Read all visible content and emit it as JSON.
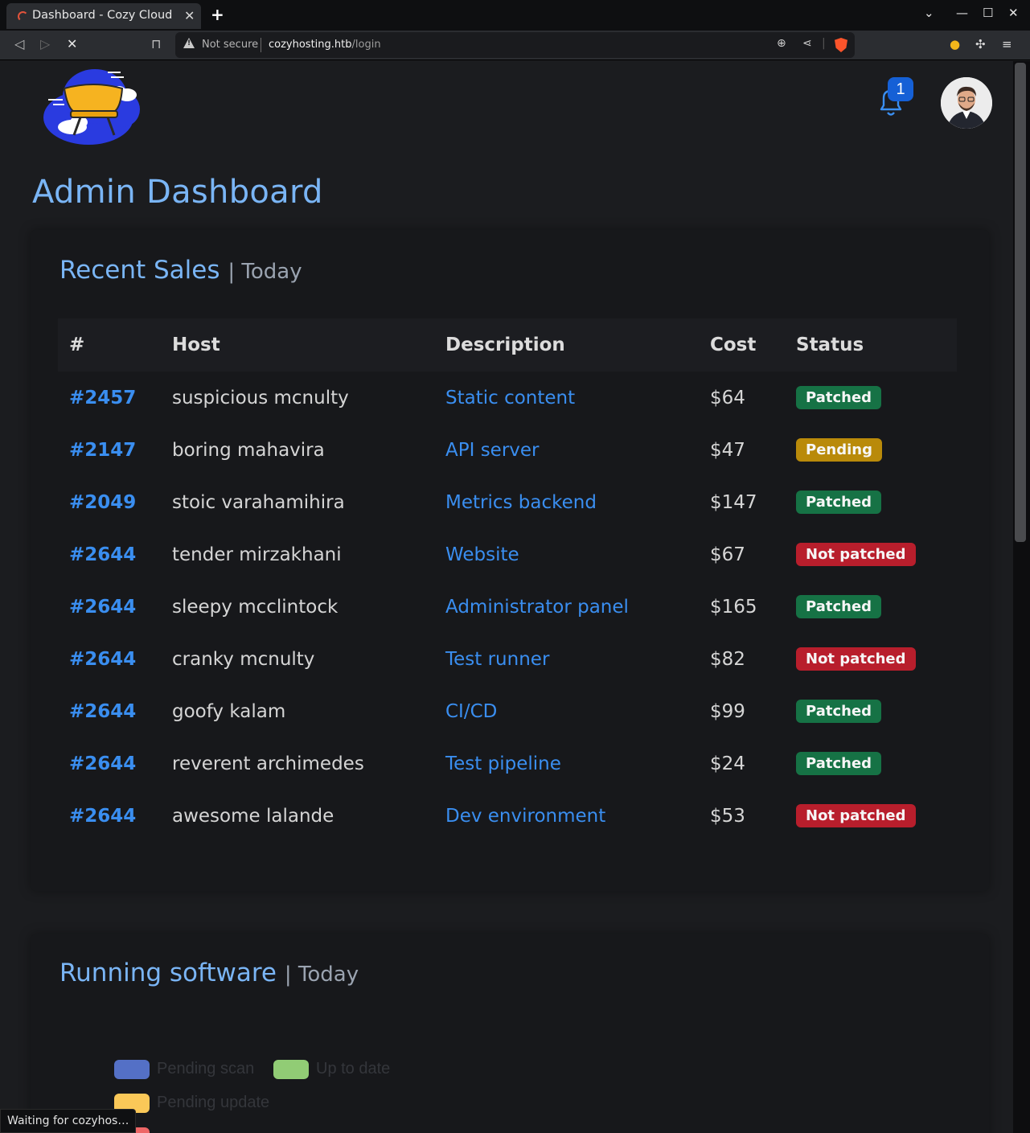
{
  "browser": {
    "tab_title": "Dashboard - Cozy Cloud",
    "url_security": "Not secure",
    "url_host": "cozyhosting.htb",
    "url_path": "/login",
    "status_text": "Waiting for cozyhos…"
  },
  "header": {
    "notification_count": "1"
  },
  "page_title": "Admin Dashboard",
  "sales": {
    "title": "Recent Sales",
    "subtitle": "| Today",
    "columns": [
      "#",
      "Host",
      "Description",
      "Cost",
      "Status"
    ],
    "rows": [
      {
        "id": "#2457",
        "host": "suspicious mcnulty",
        "desc": "Static content",
        "cost": "$64",
        "status": "Patched",
        "kind": "patched"
      },
      {
        "id": "#2147",
        "host": "boring mahavira",
        "desc": "API server",
        "cost": "$47",
        "status": "Pending",
        "kind": "pending"
      },
      {
        "id": "#2049",
        "host": "stoic varahamihira",
        "desc": "Metrics backend",
        "cost": "$147",
        "status": "Patched",
        "kind": "patched"
      },
      {
        "id": "#2644",
        "host": "tender mirzakhani",
        "desc": "Website",
        "cost": "$67",
        "status": "Not patched",
        "kind": "notpatched"
      },
      {
        "id": "#2644",
        "host": "sleepy mcclintock",
        "desc": "Administrator panel",
        "cost": "$165",
        "status": "Patched",
        "kind": "patched"
      },
      {
        "id": "#2644",
        "host": "cranky mcnulty",
        "desc": "Test runner",
        "cost": "$82",
        "status": "Not patched",
        "kind": "notpatched"
      },
      {
        "id": "#2644",
        "host": "goofy kalam",
        "desc": "CI/CD",
        "cost": "$99",
        "status": "Patched",
        "kind": "patched"
      },
      {
        "id": "#2644",
        "host": "reverent archimedes",
        "desc": "Test pipeline",
        "cost": "$24",
        "status": "Patched",
        "kind": "patched"
      },
      {
        "id": "#2644",
        "host": "awesome lalande",
        "desc": "Dev environment",
        "cost": "$53",
        "status": "Not patched",
        "kind": "notpatched"
      }
    ]
  },
  "software": {
    "title": "Running software",
    "subtitle": "| Today",
    "legend": [
      {
        "label": "Pending scan",
        "color": "#5470c6"
      },
      {
        "label": "Up to date",
        "color": "#91cc75"
      },
      {
        "label": "Pending update",
        "color": "#fac858"
      }
    ]
  },
  "colors": {
    "accent": "#7ab5f5",
    "link": "#3a8ef0",
    "patched": "#167245",
    "pending": "#b98a0a",
    "not_patched": "#b81e2c"
  }
}
